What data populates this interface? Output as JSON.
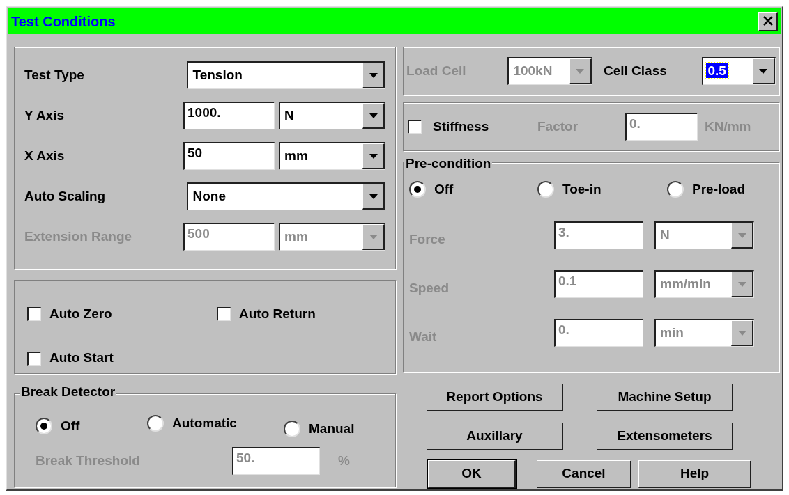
{
  "window": {
    "title": "Test Conditions"
  },
  "axes_panel": {
    "rows": [
      {
        "kind": "combo",
        "label": "Test Type",
        "value": "Tension",
        "disabled": false
      },
      {
        "kind": "value_unit",
        "label": "Y Axis",
        "value": "1000.",
        "unit": "N",
        "disabled": false
      },
      {
        "kind": "value_unit",
        "label": "X Axis",
        "value": "50",
        "unit": "mm",
        "disabled": false
      },
      {
        "kind": "combo",
        "label": "Auto Scaling",
        "value": "None",
        "disabled": false
      },
      {
        "kind": "value_unit",
        "label": "Extension Range",
        "value": "500",
        "unit": "mm",
        "disabled": true
      }
    ]
  },
  "options_panel": {
    "checkboxes": [
      {
        "label": "Auto Zero",
        "checked": false
      },
      {
        "label": "Auto Return",
        "checked": false
      },
      {
        "label": "Auto Start",
        "checked": false
      }
    ]
  },
  "break_detector": {
    "title": "Break Detector",
    "radios": [
      {
        "label": "Off",
        "selected": true
      },
      {
        "label": "Automatic",
        "selected": false
      },
      {
        "label": "Manual",
        "selected": false
      }
    ],
    "threshold": {
      "label": "Break Threshold",
      "value": "50.",
      "unit": "%",
      "disabled": true
    }
  },
  "load_cell": {
    "label": "Load Cell",
    "value": "100kN",
    "disabled": true,
    "class_label": "Cell Class",
    "class_value": "0.5",
    "class_focused": true
  },
  "stiffness": {
    "label": "Stiffness",
    "checked": false,
    "factor_label": "Factor",
    "factor_value": "0.",
    "unit": "KN/mm",
    "disabled": true
  },
  "precondition": {
    "title": "Pre-condition",
    "radios": [
      {
        "label": "Off",
        "selected": true
      },
      {
        "label": "Toe-in",
        "selected": false
      },
      {
        "label": "Pre-load",
        "selected": false
      }
    ],
    "rows": [
      {
        "label": "Force",
        "value": "3.",
        "unit": "N",
        "disabled": true
      },
      {
        "label": "Speed",
        "value": "0.1",
        "unit": "mm/min",
        "disabled": true
      },
      {
        "label": "Wait",
        "value": "0.",
        "unit": "min",
        "disabled": true
      }
    ]
  },
  "buttons": [
    {
      "label": "Report Options",
      "default": false
    },
    {
      "label": "Machine Setup",
      "default": false
    },
    {
      "label": "Auxillary",
      "default": false
    },
    {
      "label": "Extensometers",
      "default": false
    },
    {
      "label": "OK",
      "default": true
    },
    {
      "label": "Cancel",
      "default": false
    },
    {
      "label": "Help",
      "default": false
    }
  ]
}
